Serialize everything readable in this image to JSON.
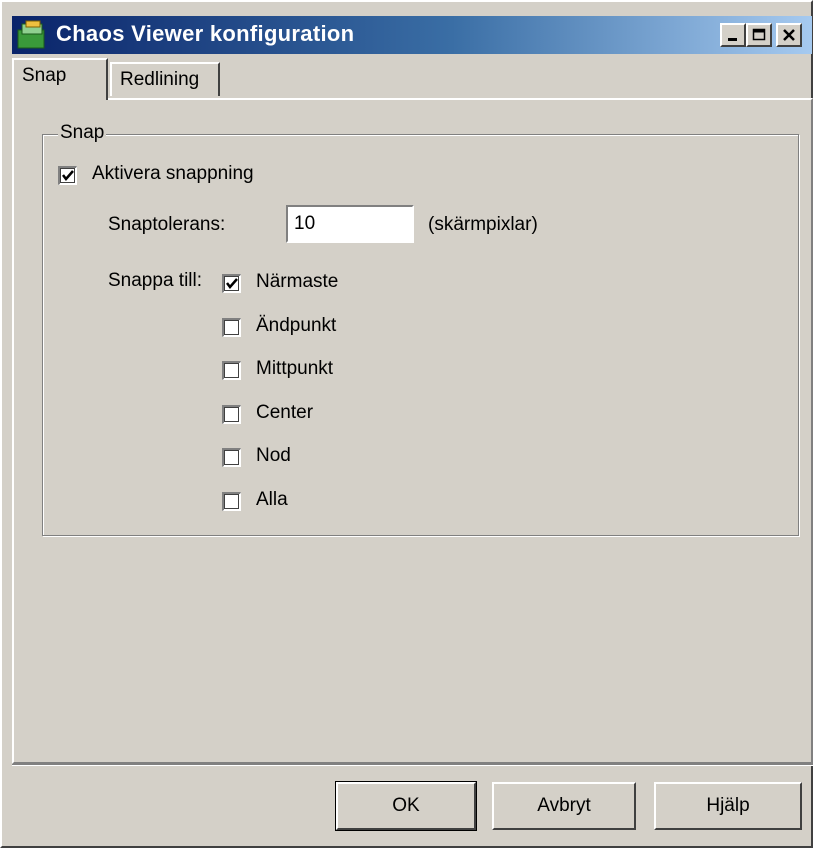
{
  "window": {
    "title": "Chaos Viewer konfiguration",
    "icons": {
      "app": "chaos-viewer-app-icon",
      "minimize": "minimize-icon",
      "maximize": "maximize-icon",
      "close": "close-icon"
    }
  },
  "tabs": [
    {
      "label": "Snap",
      "active": true
    },
    {
      "label": "Redlining",
      "active": false
    }
  ],
  "snap_group": {
    "legend": "Snap",
    "enable": {
      "label": "Aktivera snappning",
      "checked": true
    },
    "tolerance": {
      "label": "Snaptolerans:",
      "value": "10",
      "unit": "(skärmpixlar)"
    },
    "snap_to": {
      "label": "Snappa till:",
      "options": [
        {
          "label": "Närmaste",
          "checked": true
        },
        {
          "label": "Ändpunkt",
          "checked": false
        },
        {
          "label": "Mittpunkt",
          "checked": false
        },
        {
          "label": "Center",
          "checked": false
        },
        {
          "label": "Nod",
          "checked": false
        },
        {
          "label": "Alla",
          "checked": false
        }
      ]
    }
  },
  "buttons": {
    "ok": "OK",
    "cancel": "Avbryt",
    "help": "Hjälp"
  },
  "colors": {
    "face": "#d4d0c8",
    "title_start": "#0a246a",
    "title_end": "#a6caf0"
  }
}
